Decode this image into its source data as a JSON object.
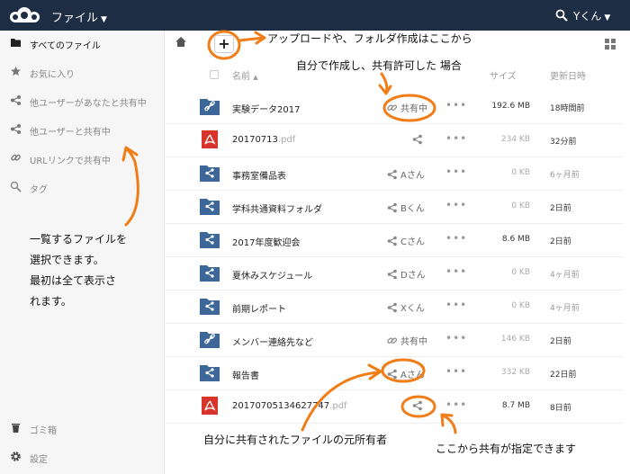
{
  "header": {
    "app_title": "ファイル",
    "user_name": "Yくん",
    "logo_icon": "cloud-logo-icon",
    "bg_color": "#1d2d44"
  },
  "sidebar": {
    "items": [
      {
        "label": "すべてのファイル",
        "icon": "folder-icon"
      },
      {
        "label": "お気に入り",
        "icon": "star-icon"
      },
      {
        "label": "他ユーザーがあなたと共有中",
        "icon": "share-icon"
      },
      {
        "label": "他ユーザーと共有中",
        "icon": "share-icon"
      },
      {
        "label": "URLリンクで共有中",
        "icon": "link-icon"
      },
      {
        "label": "タグ",
        "icon": "tag-icon"
      }
    ],
    "trash_label": "ゴミ箱",
    "settings_label": "設定"
  },
  "toolbar": {
    "add_label": "+"
  },
  "table": {
    "headers": {
      "name": "名前",
      "size": "サイズ",
      "modified": "更新日時"
    },
    "rows": [
      {
        "name": "実験データ2017",
        "ext": "",
        "type": "link-folder",
        "share": "共有中",
        "share_icon": "link-icon",
        "size": "192.6 MB",
        "modified": "18時間前"
      },
      {
        "name": "20170713",
        "ext": ".pdf",
        "type": "pdf",
        "share": "",
        "share_icon": "share-icon",
        "size": "234 KB",
        "modified": "32分前"
      },
      {
        "name": "事務室備品表",
        "ext": "",
        "type": "shared-folder",
        "share": "Aさん",
        "share_icon": "share-icon",
        "size": "0 KB",
        "modified": "6ヶ月前"
      },
      {
        "name": "学科共通資料フォルダ",
        "ext": "",
        "type": "shared-folder",
        "share": "Bくん",
        "share_icon": "share-icon",
        "size": "0 KB",
        "modified": "2日前"
      },
      {
        "name": "2017年度歓迎会",
        "ext": "",
        "type": "shared-folder",
        "share": "Cさん",
        "share_icon": "share-icon",
        "size": "8.6 MB",
        "modified": "2日前"
      },
      {
        "name": "夏休みスケジュール",
        "ext": "",
        "type": "shared-folder",
        "share": "Dさん",
        "share_icon": "share-icon",
        "size": "0 KB",
        "modified": "4ヶ月前"
      },
      {
        "name": "前期レポート",
        "ext": "",
        "type": "shared-folder",
        "share": "Xくん",
        "share_icon": "share-icon",
        "size": "0 KB",
        "modified": "4ヶ月前"
      },
      {
        "name": "メンバー連絡先など",
        "ext": "",
        "type": "link-folder",
        "share": "共有中",
        "share_icon": "link-icon",
        "size": "146 KB",
        "modified": "2日前"
      },
      {
        "name": "報告書",
        "ext": "",
        "type": "shared-folder",
        "share": "Aさん",
        "share_icon": "share-icon",
        "size": "332 KB",
        "modified": "22日前"
      },
      {
        "name": "20170705134627747",
        "ext": ".pdf",
        "type": "pdf",
        "share": "",
        "share_icon": "share-icon",
        "size": "8.7 MB",
        "modified": "8日前"
      }
    ]
  },
  "annotations": {
    "upload_note": "アップロードや、フォルダ作成はここから",
    "shared_note": "自分で作成し、共有許可した 場合",
    "select_note": [
      "一覧するファイルを",
      "選択できます。",
      "最初は全て表示さ",
      "れます。"
    ],
    "owner_note": "自分に共有されたファイルの元所有者",
    "share_here_note": "ここから共有が指定できます",
    "annotation_color": "#f07d17"
  }
}
